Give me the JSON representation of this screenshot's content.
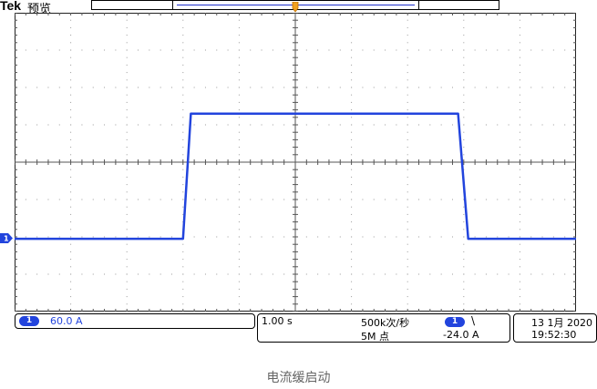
{
  "header": {
    "brand": "Tek",
    "mode": "预览"
  },
  "channel": {
    "number": "1",
    "scale": "60.0 A",
    "color": "#2244dd"
  },
  "timebase": {
    "time_per_div": "1.00 s",
    "sample_rate": "500k次/秒",
    "record_length": "5M 点"
  },
  "trigger": {
    "source": "1",
    "slope_symbol": "\\",
    "level": "-24.0 A"
  },
  "datetime": {
    "date": "13 1月 2020",
    "time": "19:52:30"
  },
  "caption": "电流缓启动",
  "chart_data": {
    "type": "line",
    "title": "",
    "xlabel": "",
    "ylabel": "",
    "grid": true,
    "divisions": {
      "x": 10,
      "y": 8
    },
    "units": {
      "x": "div",
      "y": "div"
    },
    "xlim": [
      0,
      10
    ],
    "ylim": [
      -4,
      4
    ],
    "series": [
      {
        "color": "#2244dd",
        "x": [
          0,
          3.0,
          3.14,
          4.9,
          7.9,
          8.08,
          10
        ],
        "y": [
          -2.05,
          -2.05,
          1.3,
          1.3,
          1.3,
          -2.05,
          -2.05
        ]
      }
    ]
  }
}
